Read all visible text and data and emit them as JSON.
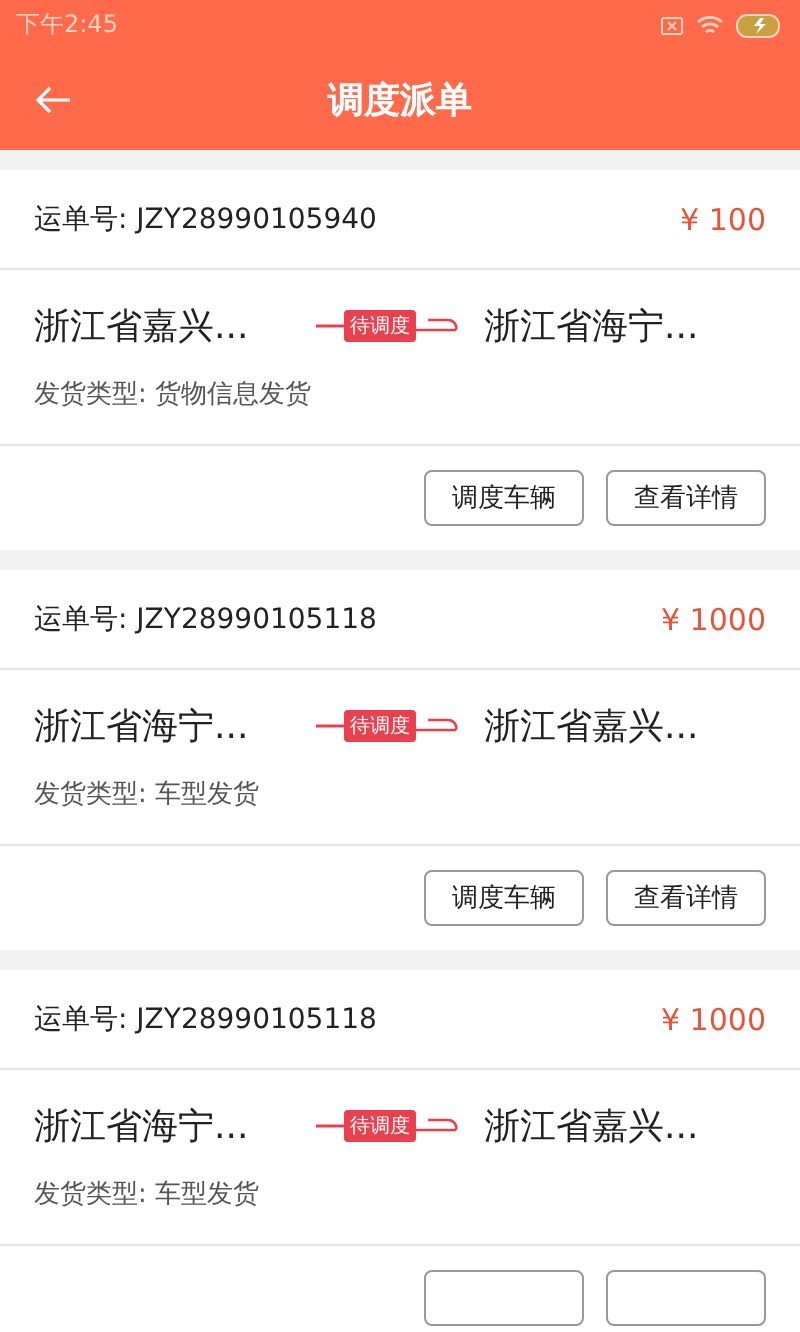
{
  "status_bar": {
    "time": "下午2:45"
  },
  "header": {
    "title": "调度派单"
  },
  "orders": [
    {
      "number_label": "运单号: JZY28990105940",
      "price": "¥ 100",
      "from": "浙江省嘉兴...",
      "to": "浙江省海宁...",
      "status": "待调度",
      "type_label": "发货类型: 货物信息发货",
      "buttons": [
        {
          "kind": "full",
          "label": "调度车辆"
        },
        {
          "kind": "full",
          "label": "查看详情"
        }
      ]
    },
    {
      "number_label": "运单号: JZY28990105118",
      "price": "¥ 1000",
      "from": "浙江省海宁...",
      "to": "浙江省嘉兴...",
      "status": "待调度",
      "type_label": "发货类型: 车型发货",
      "buttons": [
        {
          "kind": "full",
          "label": "调度车辆"
        },
        {
          "kind": "full",
          "label": "查看详情"
        }
      ]
    },
    {
      "number_label": "运单号: JZY28990105118",
      "price": "¥ 1000",
      "from": "浙江省海宁...",
      "to": "浙江省嘉兴...",
      "status": "待调度",
      "type_label": "发货类型: 车型发货",
      "buttons": [
        {
          "kind": "cut"
        },
        {
          "kind": "cut"
        }
      ]
    }
  ]
}
